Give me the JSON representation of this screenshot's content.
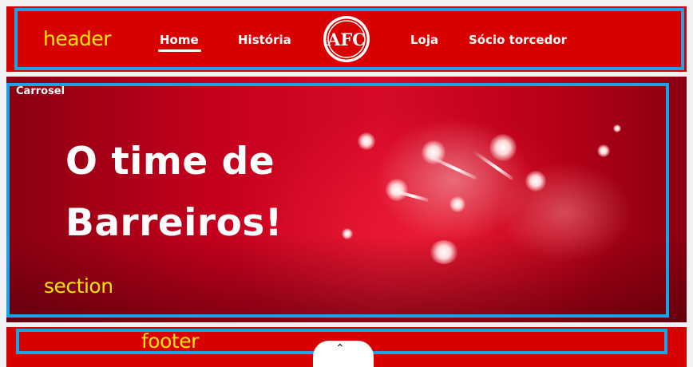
{
  "annotations": {
    "header": "header",
    "carousel": "Carrosel",
    "section": "section",
    "footer": "footer"
  },
  "nav": {
    "home": "Home",
    "historia": "História",
    "loja": "Loja",
    "socio": "Sócio torcedor"
  },
  "logo": {
    "icon": "club-crest-icon",
    "text": "AFC"
  },
  "hero": {
    "line1": "O time de",
    "line2": "Barreiros!"
  },
  "footer": {
    "scroll_icon": "chevron-up-icon",
    "scroll_glyph": "⌃"
  },
  "colors": {
    "brand_red": "#d90000",
    "annotation_yellow": "#ffe600",
    "outline_blue": "#1aa3e8"
  }
}
